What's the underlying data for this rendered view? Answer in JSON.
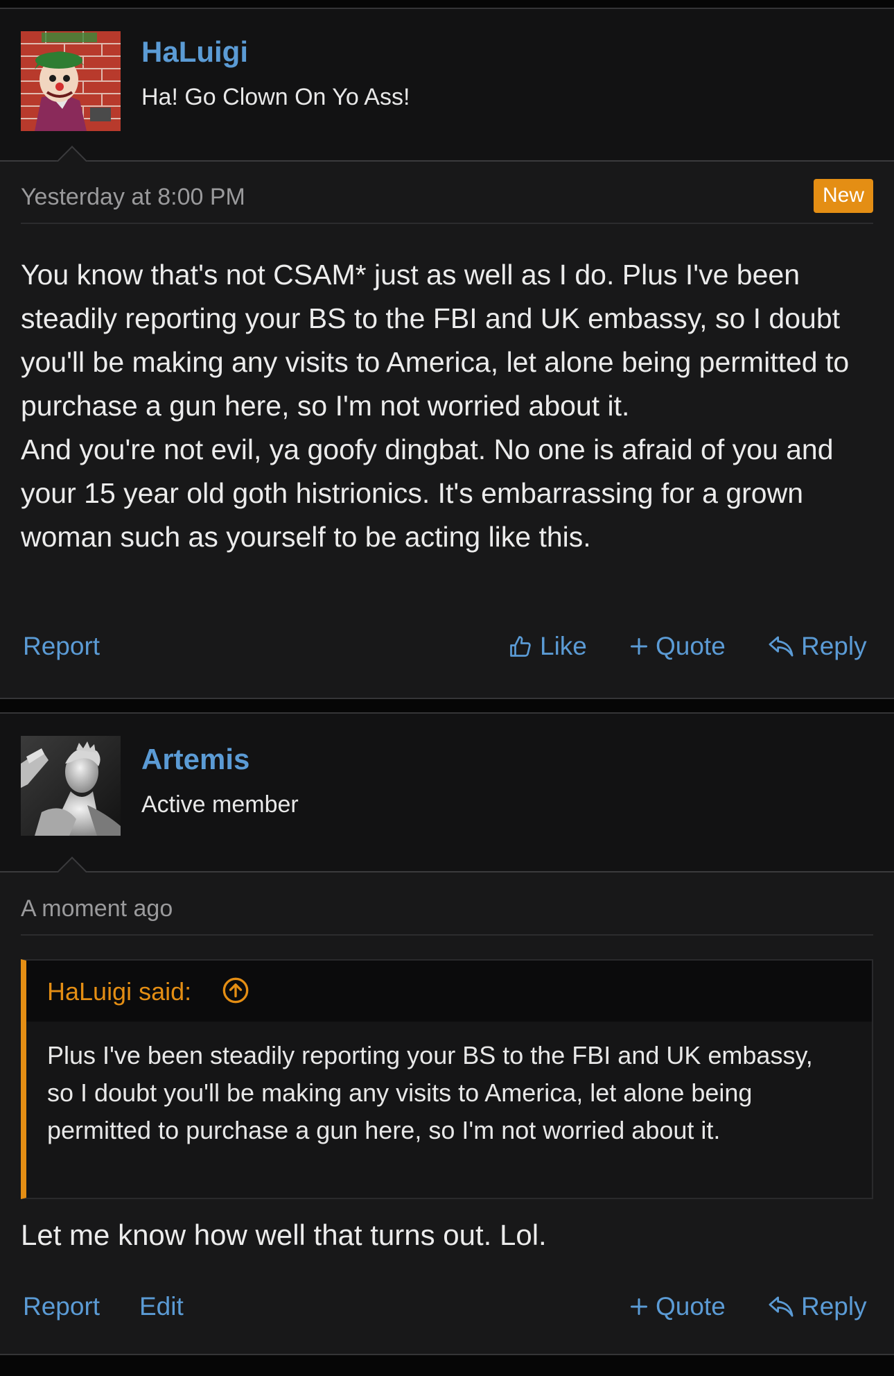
{
  "posts": [
    {
      "username": "HaLuigi",
      "user_title": "Ha! Go Clown On Yo Ass!",
      "avatar": "clown-avatar",
      "timestamp": "Yesterday at 8:00 PM",
      "badge": "New",
      "body": [
        "You know that's not CSAM* just as well as I do. Plus I've been steadily reporting your BS to the FBI and UK embassy, so I doubt you'll be making any visits to America, let alone being permitted to purchase a gun here, so I'm not worried about it.",
        "And you're not evil, ya goofy dingbat. No one is afraid of you and your 15 year old goth histrionics. It's embarrassing for a grown woman such as yourself to be acting like this."
      ],
      "actions": {
        "report": "Report",
        "like": "Like",
        "quote": "Quote",
        "reply": "Reply"
      }
    },
    {
      "username": "Artemis",
      "user_title": "Active member",
      "avatar": "statue-avatar",
      "timestamp": "A moment ago",
      "quote": {
        "author": "HaLuigi said:",
        "text": "Plus I've been steadily reporting your BS to the FBI and UK embassy, so I doubt you'll be making any visits to America, let alone being permitted to purchase a gun here, so I'm not worried about it."
      },
      "body": "Let me know how well that turns out. Lol.",
      "actions": {
        "report": "Report",
        "edit": "Edit",
        "quote": "Quote",
        "reply": "Reply"
      }
    }
  ],
  "colors": {
    "link": "#5b9bd5",
    "accent": "#e48e14",
    "background": "#181819"
  },
  "icons": [
    "thumbs-up-icon",
    "plus-icon",
    "reply-arrow-icon",
    "arrow-up-circle-icon"
  ]
}
